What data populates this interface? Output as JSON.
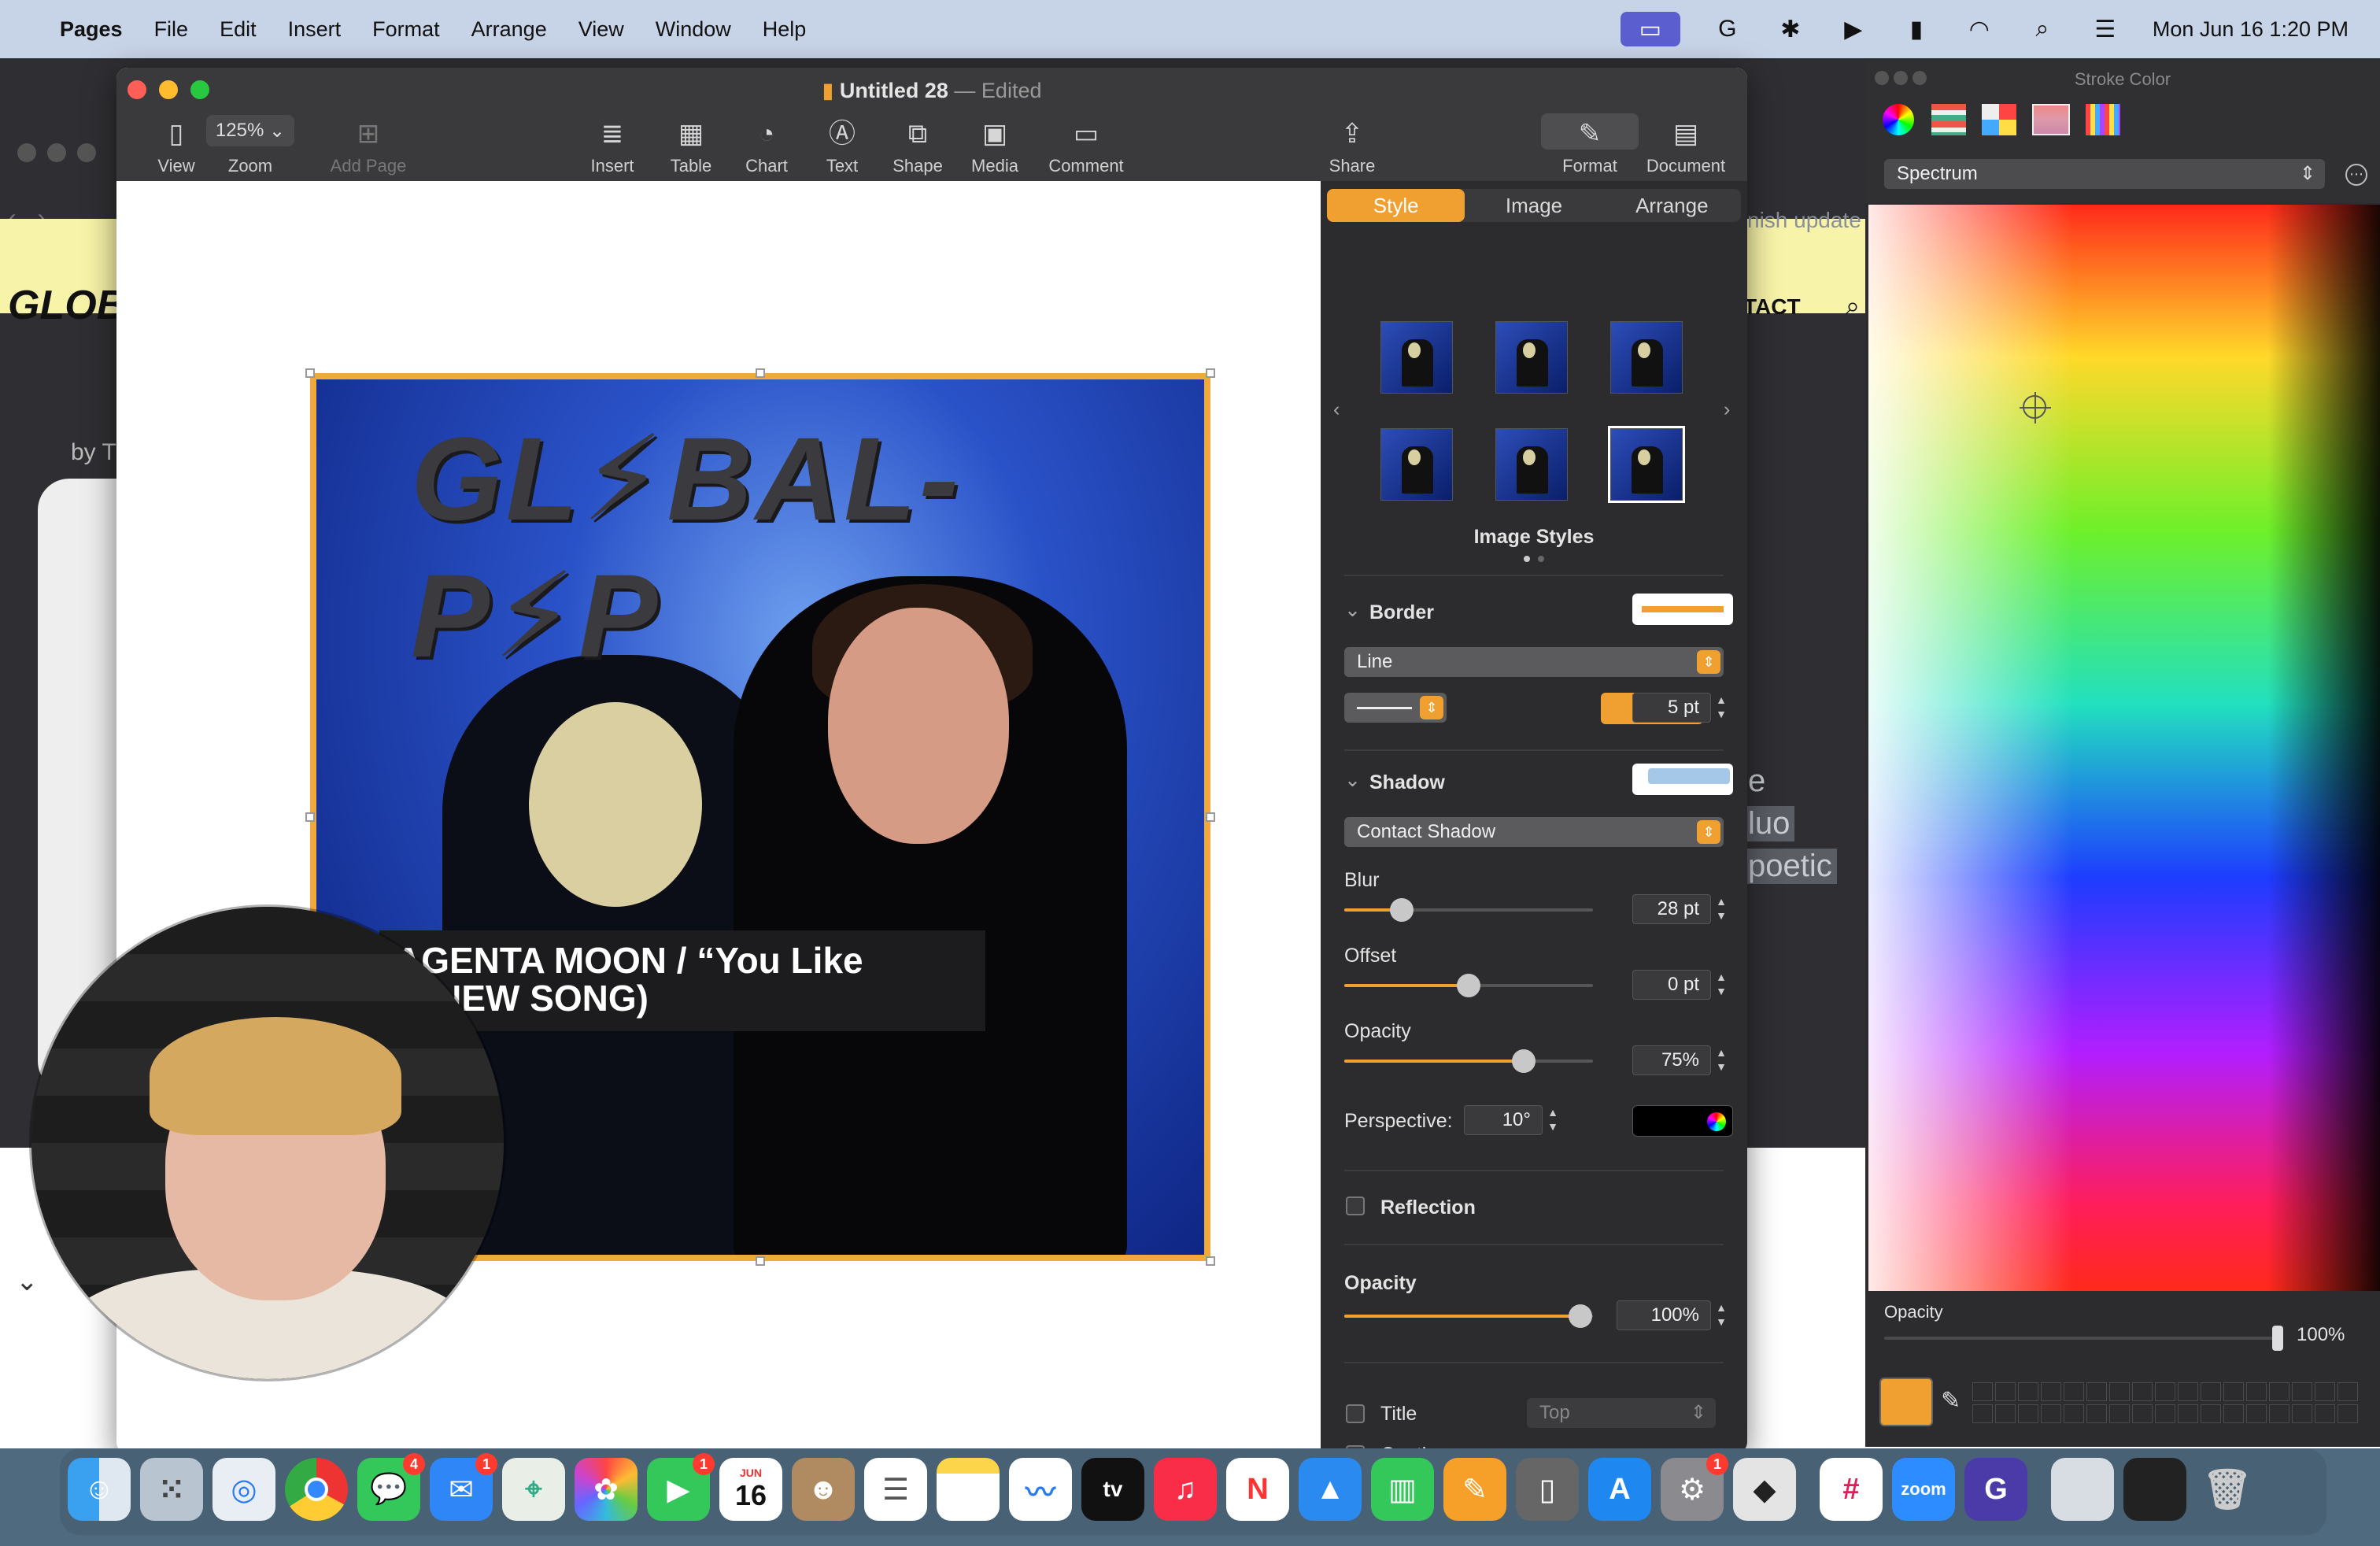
{
  "menubar": {
    "app": "Pages",
    "items": [
      "File",
      "Edit",
      "Insert",
      "Format",
      "Arrange",
      "View",
      "Window",
      "Help"
    ],
    "datetime": "Mon Jun 16  1:20 PM"
  },
  "browser": {
    "logo_text": "GLOB",
    "contact": "TACT",
    "byline": "by T",
    "update_text": "nish update",
    "highlight_lines": [
      "e",
      "luo",
      "poetic"
    ]
  },
  "window": {
    "title": "Untitled 28",
    "title_sep": "—",
    "status": "Edited",
    "toolbar": {
      "view": "View",
      "zoom_value": "125%",
      "zoom": "Zoom",
      "add_page": "Add Page",
      "insert": "Insert",
      "table": "Table",
      "chart": "Chart",
      "text": "Text",
      "shape": "Shape",
      "media": "Media",
      "comment": "Comment",
      "share": "Share",
      "format": "Format",
      "document": "Document"
    }
  },
  "cover": {
    "logo": "GL⚡BAL-P⚡P",
    "banner_line1": "AGENTA MOON / “You Like",
    "banner_line2": "” (NEW SONG)"
  },
  "inspector": {
    "tabs": [
      "Style",
      "Image",
      "Arrange"
    ],
    "image_styles_label": "Image Styles",
    "border_label": "Border",
    "border_type": "Line",
    "border_width": "5 pt",
    "shadow_label": "Shadow",
    "shadow_type": "Contact Shadow",
    "blur_label": "Blur",
    "blur_value": "28 pt",
    "blur_level": 0.23,
    "offset_label": "Offset",
    "offset_value": "0 pt",
    "offset_level": 0.5,
    "shadow_opacity_label": "Opacity",
    "shadow_opacity_value": "75%",
    "shadow_opacity_level": 0.72,
    "perspective_label": "Perspective:",
    "perspective_value": "10°",
    "reflection_label": "Reflection",
    "opacity_label": "Opacity",
    "opacity_value": "100%",
    "opacity_level": 0.95,
    "title_label": "Title",
    "title_position": "Top",
    "caption_label": "Caption",
    "accent": "#f0a030"
  },
  "stroke_color": {
    "title": "Stroke Color",
    "mode": "Spectrum",
    "opacity_label": "Opacity",
    "opacity_value": "100%",
    "current_color": "#f0a030"
  },
  "dock": {
    "badges": {
      "messages": "4",
      "mail": "1",
      "facetime": "1",
      "settings": "1"
    },
    "calendar_month": "JUN",
    "calendar_day": "16",
    "zoom_label": "zoom",
    "appletv_label": "tv"
  }
}
